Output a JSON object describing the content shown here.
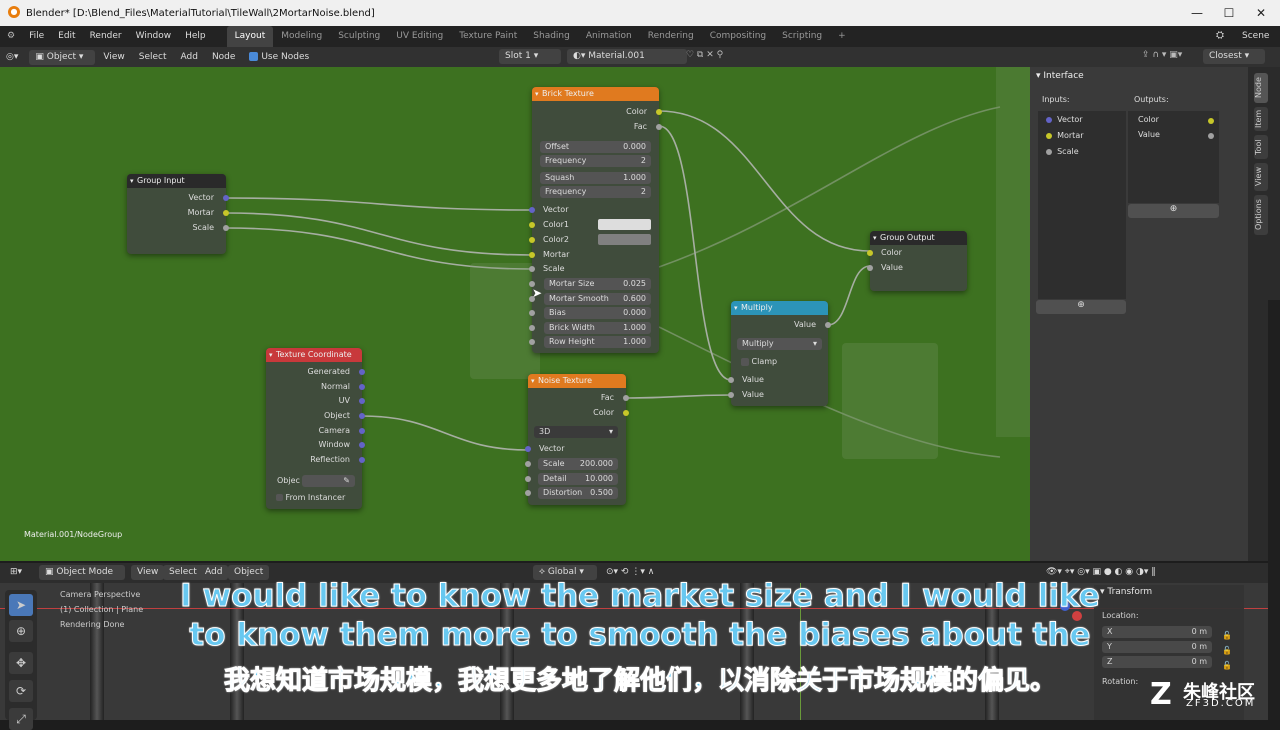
{
  "window": {
    "title": "Blender* [D:\\Blend_Files\\MaterialTutorial\\TileWall\\2MortarNoise.blend]"
  },
  "menu": {
    "items": [
      "File",
      "Edit",
      "Render",
      "Window",
      "Help"
    ]
  },
  "workspaces": [
    "Layout",
    "Modeling",
    "Sculpting",
    "UV Editing",
    "Texture Paint",
    "Shading",
    "Animation",
    "Rendering",
    "Compositing",
    "Scripting"
  ],
  "scene_label": "Scene",
  "node_header": {
    "mode": "Object",
    "view": "View",
    "select": "Select",
    "add": "Add",
    "node": "Node",
    "use_nodes": "Use Nodes",
    "slot": "Slot 1",
    "material": "Material.001",
    "snap": "Closest"
  },
  "editor": {
    "breadcrumb": "Material.001/NodeGroup"
  },
  "nodes": {
    "group_input": {
      "title": "Group Input",
      "outputs": [
        "Vector",
        "Mortar",
        "Scale"
      ]
    },
    "brick": {
      "title": "Brick Texture",
      "outputs": [
        "Color",
        "Fac"
      ],
      "offset": {
        "label": "Offset",
        "value": "0.000"
      },
      "freq1": {
        "label": "Frequency",
        "value": "2"
      },
      "squash": {
        "label": "Squash",
        "value": "1.000"
      },
      "freq2": {
        "label": "Frequency",
        "value": "2"
      },
      "inputs": [
        "Vector",
        "Color1",
        "Color2",
        "Mortar",
        "Scale"
      ],
      "params": [
        {
          "label": "Mortar Size",
          "value": "0.025"
        },
        {
          "label": "Mortar Smooth",
          "value": "0.600"
        },
        {
          "label": "Bias",
          "value": "0.000"
        },
        {
          "label": "Brick Width",
          "value": "1.000"
        },
        {
          "label": "Row Height",
          "value": "1.000"
        }
      ]
    },
    "group_output": {
      "title": "Group Output",
      "inputs": [
        "Color",
        "Value"
      ]
    },
    "multiply": {
      "title": "Multiply",
      "output": "Value",
      "op": "Multiply",
      "clamp": "Clamp",
      "inputs": [
        "Value",
        "Value"
      ]
    },
    "texcoord": {
      "title": "Texture Coordinate",
      "outputs": [
        "Generated",
        "Normal",
        "UV",
        "Object",
        "Camera",
        "Window",
        "Reflection"
      ],
      "object_label": "Objec",
      "from_instancer": "From Instancer"
    },
    "noise": {
      "title": "Noise Texture",
      "outputs": [
        "Fac",
        "Color"
      ],
      "dim": "3D",
      "vector": "Vector",
      "params": [
        {
          "label": "Scale",
          "value": "200.000"
        },
        {
          "label": "Detail",
          "value": "10.000"
        },
        {
          "label": "Distortion",
          "value": "0.500"
        }
      ]
    }
  },
  "npanel": {
    "section": "Interface",
    "inputs_label": "Inputs:",
    "outputs_label": "Outputs:",
    "inputs": [
      "Vector",
      "Mortar",
      "Scale"
    ],
    "outputs": [
      "Color",
      "Value"
    ],
    "tabs": [
      "Node",
      "Item",
      "Tool",
      "View",
      "Options"
    ]
  },
  "viewport_header": {
    "mode": "Object Mode",
    "view": "View",
    "select": "Select",
    "add": "Add",
    "object": "Object",
    "orient": "Global"
  },
  "viewport": {
    "line1": "Camera Perspective",
    "line2": "(1) Collection | Plane",
    "line3": "Rendering Done"
  },
  "transform": {
    "title": "Transform",
    "location": "Location:",
    "x": "X",
    "y": "Y",
    "z": "Z",
    "xv": "0 m",
    "yv": "0 m",
    "zv": "0 m",
    "rotation": "Rotation:"
  },
  "subtitles": {
    "en1": "I would like to know the market size and I would like",
    "en2": "to know them more to smooth the biases about the",
    "zh": "我想知道市场规模，我想更多地了解他们，以消除关于市场规模的偏见。"
  },
  "watermark": {
    "brand": "朱峰社区",
    "url": "ZF3D.COM"
  },
  "colors": {
    "editor_bg": "#3d7120",
    "brick_header": "#e07a1f",
    "texcoord_header": "#c8393b",
    "multiply_header": "#2c94b8",
    "group_header": "#2a2a2a"
  }
}
